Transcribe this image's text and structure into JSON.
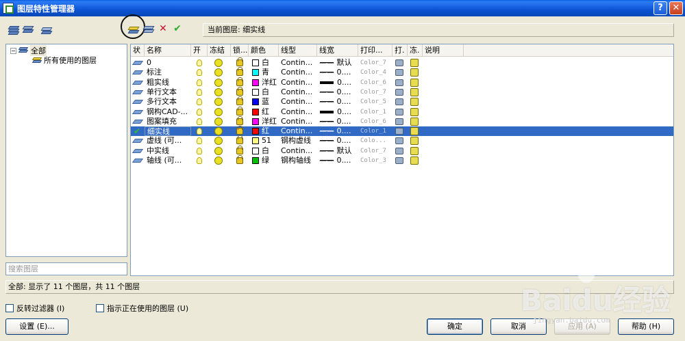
{
  "window": {
    "title": "图层特性管理器",
    "help_label": "?",
    "close_label": "✕"
  },
  "toolbar": {
    "current_layer_label": "当前图层: 细实线"
  },
  "tree": {
    "root_label": "全部",
    "child_label": "所有使用的图层",
    "search_placeholder": "搜索图层"
  },
  "columns": [
    "状",
    "名称",
    "开",
    "冻结",
    "锁...",
    "颜色",
    "线型",
    "线宽",
    "打印...",
    "打.",
    "冻.",
    "说明"
  ],
  "layers": [
    {
      "name": "0",
      "color_name": "白",
      "color_hex": "#FFFFFF",
      "linetype": "Contin...",
      "lineweight": "—— 默认",
      "plot_style": "Color_7",
      "thick": false
    },
    {
      "name": "标注",
      "color_name": "青",
      "color_hex": "#00FFFF",
      "linetype": "Contin...",
      "lineweight": "—— 0....",
      "plot_style": "Color_4",
      "thick": false
    },
    {
      "name": "粗实线",
      "color_name": "洋红",
      "color_hex": "#FF00FF",
      "linetype": "Contin...",
      "lineweight": "0....",
      "plot_style": "Color_6",
      "thick": true
    },
    {
      "name": "单行文本",
      "color_name": "白",
      "color_hex": "#FFFFFF",
      "linetype": "Contin...",
      "lineweight": "—— 0....",
      "plot_style": "Color_7",
      "thick": false
    },
    {
      "name": "多行文本",
      "color_name": "蓝",
      "color_hex": "#0000FF",
      "linetype": "Contin...",
      "lineweight": "—— 0....",
      "plot_style": "Color_5",
      "thick": false
    },
    {
      "name": "钢构CAD-...",
      "color_name": "红",
      "color_hex": "#FF0000",
      "linetype": "Contin...",
      "lineweight": "0....",
      "plot_style": "Color_1",
      "thick": true
    },
    {
      "name": "图案填充",
      "color_name": "洋红",
      "color_hex": "#FF00FF",
      "linetype": "Contin...",
      "lineweight": "—— 0....",
      "plot_style": "Color_6",
      "thick": false
    },
    {
      "name": "细实线",
      "color_name": "红",
      "color_hex": "#FF0000",
      "linetype": "Contin...",
      "lineweight": "—— 0....",
      "plot_style": "Color_1",
      "thick": false,
      "selected": true
    },
    {
      "name": "虚线 (可...",
      "color_name": "51",
      "color_hex": "#FFFF80",
      "linetype": "钢构虚线",
      "lineweight": "—— 0....",
      "plot_style": "Colo...",
      "thick": false
    },
    {
      "name": "中实线",
      "color_name": "白",
      "color_hex": "#FFFFFF",
      "linetype": "Contin...",
      "lineweight": "—— 默认",
      "plot_style": "Color_7",
      "thick": false
    },
    {
      "name": "轴线 (可...",
      "color_name": "绿",
      "color_hex": "#00C000",
      "linetype": "钢构轴线",
      "lineweight": "—— 0....",
      "plot_style": "Color_3",
      "thick": false
    }
  ],
  "status_text": "全部: 显示了 11 个图层，共 11 个图层",
  "options": {
    "invert_filter": "反转过滤器 (I)",
    "indicate_in_use": "指示正在使用的图层 (U)"
  },
  "buttons": {
    "settings": "设置 (E)...",
    "ok": "确定",
    "cancel": "取消",
    "apply": "应用 (A)",
    "help": "帮助 (H)"
  },
  "watermark": {
    "main": "Baidu经验",
    "sub": "jingyan.baidu.com"
  }
}
